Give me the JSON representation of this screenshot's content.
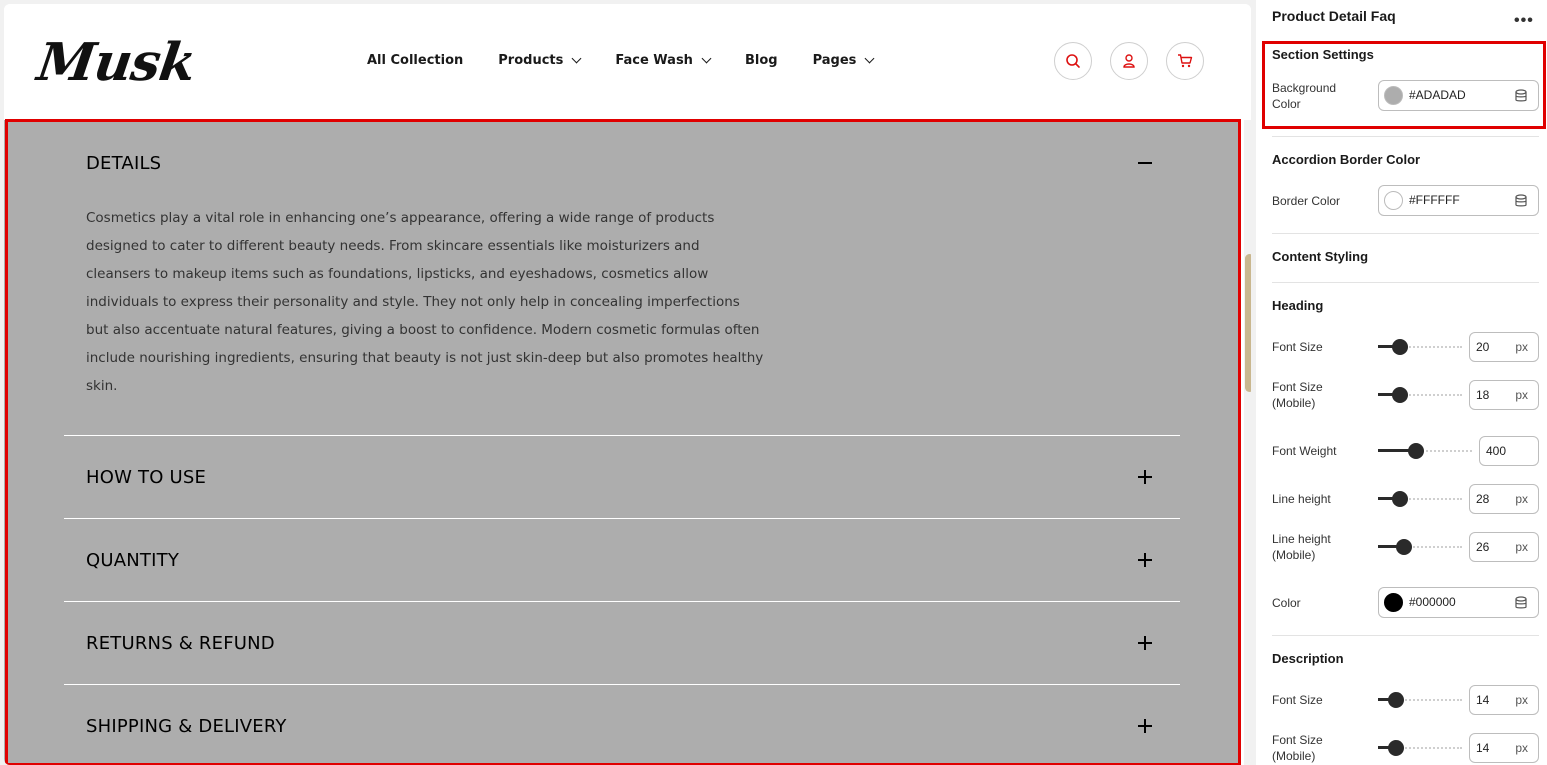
{
  "header": {
    "logo": "Musk",
    "nav": [
      {
        "label": "All Collection",
        "dropdown": false
      },
      {
        "label": "Products",
        "dropdown": true
      },
      {
        "label": "Face Wash",
        "dropdown": true
      },
      {
        "label": "Blog",
        "dropdown": false
      },
      {
        "label": "Pages",
        "dropdown": true
      }
    ],
    "icons": [
      "search-icon",
      "user-icon",
      "cart-icon"
    ]
  },
  "faq": {
    "background": "#ADADAD",
    "items": [
      {
        "title": "DETAILS",
        "expanded": true,
        "description": "Cosmetics play a vital role in enhancing one’s appearance, offering a wide range of products designed to cater to different beauty needs. From skincare essentials like moisturizers and cleansers to makeup items such as foundations, lipsticks, and eyeshadows, cosmetics allow individuals to express their personality and style. They not only help in concealing imperfections but also accentuate natural features, giving a boost to confidence. Modern cosmetic formulas often include nourishing ingredients, ensuring that beauty is not just skin-deep but also promotes healthy skin."
      },
      {
        "title": "HOW TO USE",
        "expanded": false
      },
      {
        "title": "QUANTITY",
        "expanded": false
      },
      {
        "title": "RETURNS & REFUND",
        "expanded": false
      },
      {
        "title": "SHIPPING & DELIVERY",
        "expanded": false
      }
    ]
  },
  "panel": {
    "title": "Product Detail Faq",
    "section_settings": {
      "heading": "Section Settings",
      "background_label": "Background Color",
      "background_value": "#ADADAD"
    },
    "accordion_border": {
      "heading": "Accordion Border Color",
      "border_label": "Border Color",
      "border_value": "#FFFFFF"
    },
    "content_styling": "Content Styling",
    "heading_group": {
      "heading": "Heading",
      "font_size_label": "Font Size",
      "font_size": "20",
      "font_size_mobile_label": "Font Size (Mobile)",
      "font_size_mobile": "18",
      "font_weight_label": "Font Weight",
      "font_weight": "400",
      "line_height_label": "Line height",
      "line_height": "28",
      "line_height_mobile_label": "Line height (Mobile)",
      "line_height_mobile": "26",
      "color_label": "Color",
      "color_value": "#000000",
      "unit": "px"
    },
    "description_group": {
      "heading": "Description",
      "font_size_label": "Font Size",
      "font_size": "14",
      "font_size_mobile_label": "Font Size (Mobile)",
      "font_size_mobile": "14",
      "unit": "px"
    }
  },
  "colors": {
    "highlight": "#E00000",
    "scroll_thumb": "#C9B78F"
  }
}
